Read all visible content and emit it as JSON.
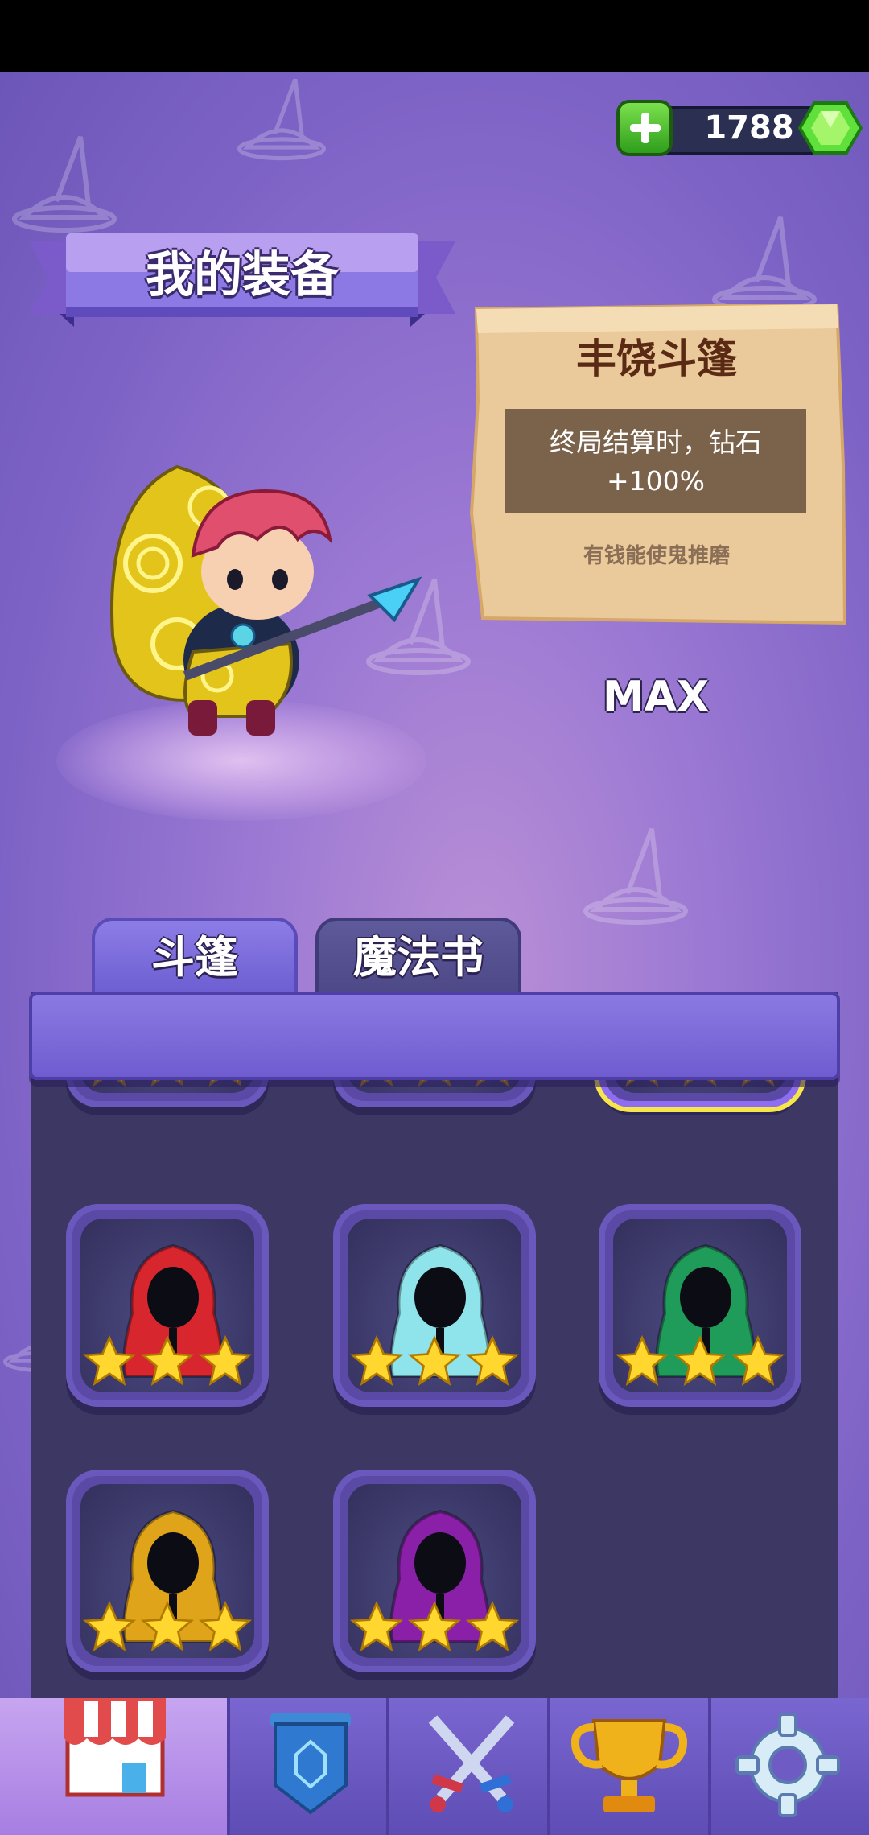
{
  "currency": {
    "amount": "1788",
    "add_icon": "plus-icon",
    "gem_icon": "green-gem-icon"
  },
  "title": "我的装备",
  "item": {
    "name": "丰饶斗篷",
    "description": "终局结算时，钻石 +100%",
    "quote": "有钱能使鬼推磨",
    "level_label": "MAX"
  },
  "tabs": [
    {
      "label": "斗篷",
      "active": true
    },
    {
      "label": "魔法书",
      "active": false
    }
  ],
  "inventory": [
    {
      "color": "#d63ad0",
      "stars": 3,
      "selected": false
    },
    {
      "color": "#b740c9",
      "stars": 3,
      "selected": false
    },
    {
      "color": "#e6c21a",
      "stars": 3,
      "selected": true
    },
    {
      "color": "#d8262e",
      "stars": 3,
      "selected": false
    },
    {
      "color": "#8fe3ea",
      "stars": 3,
      "selected": false
    },
    {
      "color": "#1f9c5a",
      "stars": 3,
      "selected": false
    },
    {
      "color": "#e0a41a",
      "stars": 3,
      "selected": false
    },
    {
      "color": "#8a1fa8",
      "stars": 3,
      "selected": false
    }
  ],
  "nav": [
    "shop-icon",
    "shield-icon",
    "crossed-swords-icon",
    "trophy-icon",
    "gear-icon"
  ]
}
